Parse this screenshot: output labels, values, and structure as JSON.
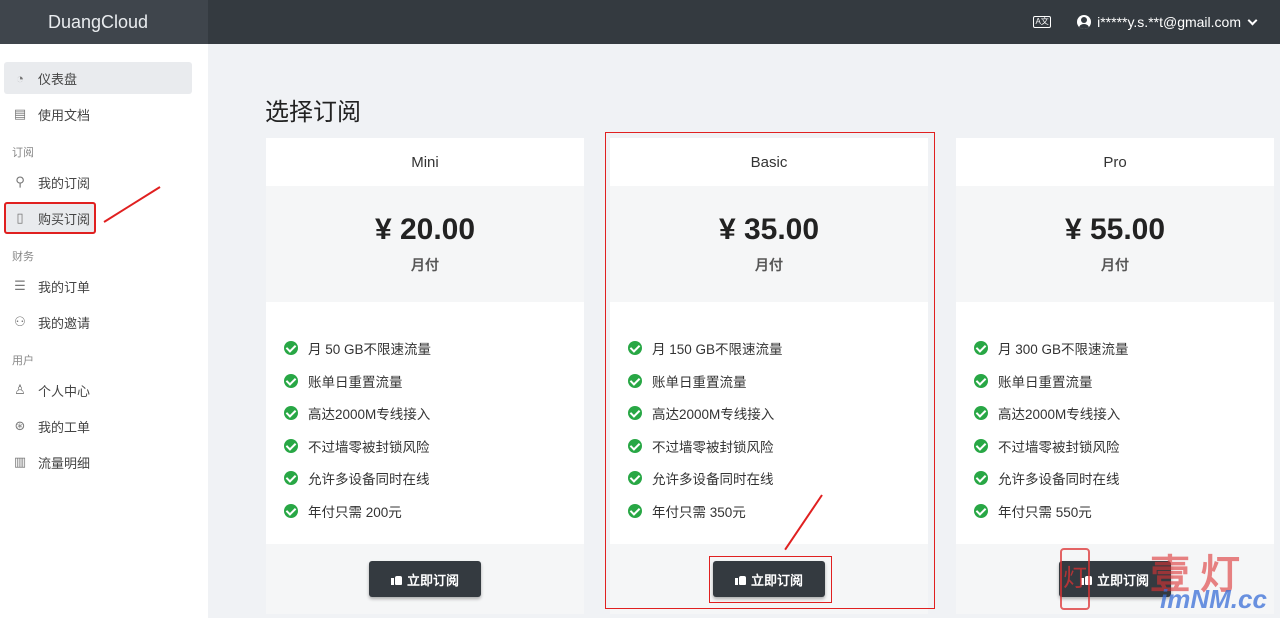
{
  "header": {
    "brand": "DuangCloud",
    "lang_icon_text": "A文",
    "user_email": "i*****y.s.**t@gmail.com"
  },
  "sidebar": {
    "items": [
      {
        "label": "仪表盘",
        "icon": "dashboard-icon"
      },
      {
        "label": "使用文档",
        "icon": "book-icon"
      }
    ],
    "sections": [
      {
        "title": "订阅",
        "items": [
          {
            "label": "我的订阅",
            "icon": "rocket-icon"
          },
          {
            "label": "购买订阅",
            "icon": "clipboard-icon"
          }
        ]
      },
      {
        "title": "财务",
        "items": [
          {
            "label": "我的订单",
            "icon": "list-icon"
          },
          {
            "label": "我的邀请",
            "icon": "users-icon"
          }
        ]
      },
      {
        "title": "用户",
        "items": [
          {
            "label": "个人中心",
            "icon": "user-icon"
          },
          {
            "label": "我的工单",
            "icon": "support-icon"
          },
          {
            "label": "流量明细",
            "icon": "bar-chart-icon"
          }
        ]
      }
    ]
  },
  "main": {
    "title": "选择订阅",
    "plans": [
      {
        "name": "Mini",
        "price": "¥ 20.00",
        "period": "月付",
        "features": [
          "月 50 GB不限速流量",
          "账单日重置流量",
          "高达2000M专线接入",
          "不过墙零被封锁风险",
          "允许多设备同时在线",
          "年付只需 200元"
        ],
        "button": "立即订阅"
      },
      {
        "name": "Basic",
        "price": "¥ 35.00",
        "period": "月付",
        "features": [
          "月 150 GB不限速流量",
          "账单日重置流量",
          "高达2000M专线接入",
          "不过墙零被封锁风险",
          "允许多设备同时在线",
          "年付只需 350元"
        ],
        "button": "立即订阅"
      },
      {
        "name": "Pro",
        "price": "¥ 55.00",
        "period": "月付",
        "features": [
          "月 300 GB不限速流量",
          "账单日重置流量",
          "高达2000M专线接入",
          "不过墙零被封锁风险",
          "允许多设备同时在线",
          "年付只需 550元"
        ],
        "button": "立即订阅"
      }
    ]
  },
  "watermark": {
    "seal_text": "灯",
    "chinese": "壹灯",
    "domain": "imNM.cc"
  },
  "colors": {
    "header_bg": "#343a40",
    "check_green": "#28a745",
    "annotation_red": "#e02020"
  }
}
